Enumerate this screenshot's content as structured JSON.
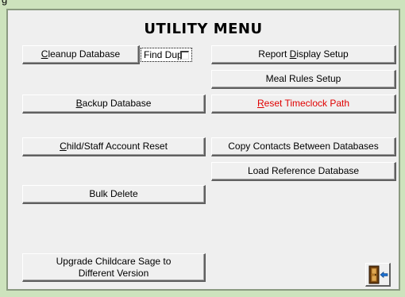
{
  "window": {
    "title_fragment": "g"
  },
  "menu": {
    "title": "UTILITY MENU"
  },
  "buttons": {
    "cleanup_database": {
      "pre": "",
      "key": "C",
      "post": "leanup Database"
    },
    "find_dups": {
      "label": "Find Dups",
      "checked": false
    },
    "report_display_setup": {
      "pre": "Report ",
      "key": "D",
      "post": "isplay Setup"
    },
    "meal_rules_setup": {
      "label": "Meal Rules Setup"
    },
    "backup_database": {
      "pre": "",
      "key": "B",
      "post": "ackup Database"
    },
    "reset_timeclock_path": {
      "pre": "",
      "key": "R",
      "post": "eset Timeclock Path",
      "color": "#e00000"
    },
    "child_staff_account_reset": {
      "pre": "",
      "key": "C",
      "post": "hild/Staff Account Reset"
    },
    "copy_contacts": {
      "label": "Copy Contacts Between Databases"
    },
    "load_reference_database": {
      "label": "Load Reference Database"
    },
    "bulk_delete": {
      "label": "Bulk Delete"
    },
    "upgrade": {
      "pre": "Up",
      "key": "g",
      "post": "rade Childcare Sage to",
      "line2": "Different Version"
    }
  },
  "icons": {
    "exit": "exit-door-icon"
  },
  "colors": {
    "window_bg": "#cde3bd",
    "panel_bg": "#efefef",
    "accent_red": "#e00000"
  }
}
